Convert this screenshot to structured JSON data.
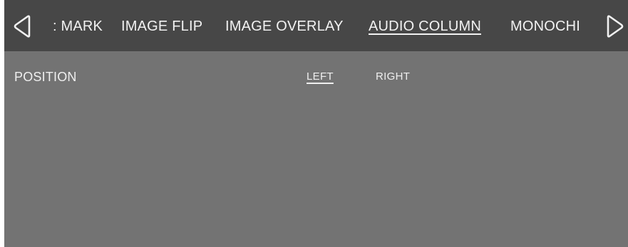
{
  "tabs": [
    {
      "label": ": MARK",
      "active": false
    },
    {
      "label": "IMAGE FLIP",
      "active": false
    },
    {
      "label": "IMAGE OVERLAY",
      "active": false
    },
    {
      "label": "AUDIO COLUMN",
      "active": true
    },
    {
      "label": "MONOCHI",
      "active": false
    }
  ],
  "nav": {
    "prev_icon": "chevron-left-outline-icon",
    "next_icon": "chevron-right-outline-icon"
  },
  "setting": {
    "label": "POSITION",
    "options": [
      {
        "label": "LEFT",
        "selected": true
      },
      {
        "label": "RIGHT",
        "selected": false
      }
    ]
  },
  "colors": {
    "tab_bar_background": "#474747",
    "panel_background": "#737373",
    "text": "#f2f2f2"
  }
}
